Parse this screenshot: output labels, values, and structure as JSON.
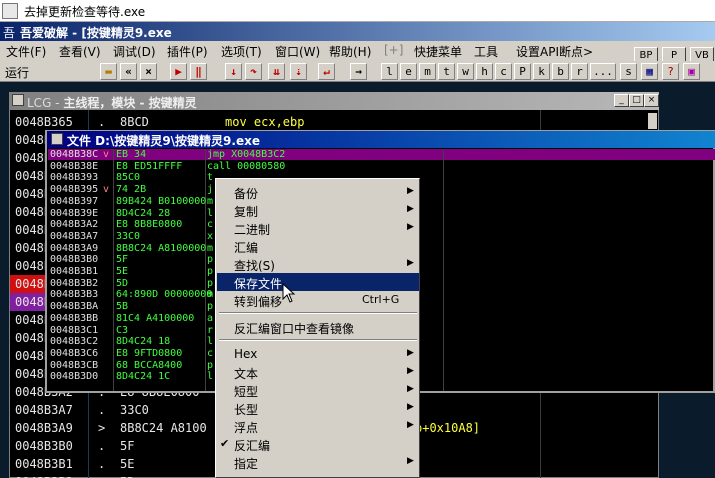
{
  "window": {
    "title": "去掉更新检查等待.exe"
  },
  "app": {
    "icon": "吾",
    "title": "吾爱破解 - [按键精灵9.exe"
  },
  "menu": {
    "items": [
      "文件(F)",
      "查看(V)",
      "调试(D)",
      "插件(P)",
      "选项(T)",
      "窗口(W)",
      "帮助(H)",
      "[+]",
      "快捷菜单",
      "工具",
      "设置API断点>"
    ],
    "right_buttons": [
      "BP",
      "P",
      "VB"
    ]
  },
  "toolbar": {
    "run_label": "运行",
    "letters": [
      "l",
      "e",
      "m",
      "t",
      "w",
      "h",
      "c",
      "P",
      "k",
      "b",
      "r",
      "...",
      "s"
    ]
  },
  "lcg": {
    "title_prefix": "LCG - ",
    "title_rest": "主线程，模块 - 按键精灵",
    "rows": [
      {
        "addr": "0048B365",
        "mark": ".",
        "hex": "8BCD",
        "dis": "mov ecx,ebp"
      },
      {
        "addr": "0048B367",
        "mark": "",
        "hex": "",
        "dis": ""
      },
      {
        "addr": "0048B36C",
        "mark": "",
        "hex": "",
        "dis": ""
      },
      {
        "addr": "0048B36E",
        "mark": "",
        "hex": "",
        "dis": ""
      },
      {
        "addr": "0048B371",
        "mark": "",
        "hex": "",
        "dis": ""
      },
      {
        "addr": "0048B378",
        "mark": "",
        "hex": "",
        "dis": ""
      },
      {
        "addr": "0048B37A",
        "mark": "",
        "hex": "",
        "dis": ""
      },
      {
        "addr": "0048B380",
        "mark": "",
        "hex": "",
        "dis": ""
      },
      {
        "addr": "0048B384",
        "mark": "",
        "hex": "",
        "dis": ""
      },
      {
        "addr": "0048B387",
        "mark": "",
        "hex": "",
        "dis": ""
      },
      {
        "addr": "0048B38C",
        "mark": "",
        "hex": "",
        "dis": ""
      },
      {
        "addr": "0048B393",
        "mark": "",
        "hex": "",
        "dis": ""
      },
      {
        "addr": "0048B395",
        "mark": "",
        "hex": "",
        "dis": ""
      },
      {
        "addr": "0048B397",
        "mark": "",
        "hex": "",
        "dis": ""
      },
      {
        "addr": "0048B39E",
        "mark": "",
        "hex": "",
        "dis": ""
      },
      {
        "addr": "0048B3A2",
        "mark": ".",
        "hex": "E8 8B8E0800",
        "dis": ""
      },
      {
        "addr": "0048B3A7",
        "mark": ".",
        "hex": "33C0",
        "dis": ""
      },
      {
        "addr": "0048B3A9",
        "mark": ">",
        "hex": "8B8C24 A8100",
        "dis": "p+0x10A8]"
      },
      {
        "addr": "0048B3B0",
        "mark": ".",
        "hex": "5F",
        "dis": ""
      },
      {
        "addr": "0048B3B1",
        "mark": ".",
        "hex": "5E",
        "dis": ""
      },
      {
        "addr": "0048B3B2",
        "mark": ".",
        "hex": "5D",
        "dis": ""
      }
    ]
  },
  "file_window": {
    "title": "文件 D:\\按键精灵9\\按键精灵9.exe",
    "rows": [
      {
        "addr": "0048B38C",
        "mark": "v",
        "hex": "EB 34",
        "dis": "jmp X0048B3C2"
      },
      {
        "addr": "0048B38E",
        "mark": "",
        "hex": "E8 ED51FFFF",
        "dis": "call 00080580"
      },
      {
        "addr": "0048B393",
        "mark": "",
        "hex": "85C0",
        "dis": "t"
      },
      {
        "addr": "0048B395",
        "mark": "v",
        "hex": "74 2B",
        "dis": "j"
      },
      {
        "addr": "0048B397",
        "mark": "",
        "hex": "89B424 B0100000",
        "dis": "m"
      },
      {
        "addr": "0048B39E",
        "mark": "",
        "hex": "8D4C24 28",
        "dis": "l"
      },
      {
        "addr": "0048B3A2",
        "mark": "",
        "hex": "E8 8B8E0800",
        "dis": "c"
      },
      {
        "addr": "0048B3A7",
        "mark": "",
        "hex": "33C0",
        "dis": "x"
      },
      {
        "addr": "0048B3A9",
        "mark": "",
        "hex": "8B8C24 A8100000",
        "dis": "m"
      },
      {
        "addr": "0048B3B0",
        "mark": "",
        "hex": "5F",
        "dis": "p"
      },
      {
        "addr": "0048B3B1",
        "mark": "",
        "hex": "5E",
        "dis": "p"
      },
      {
        "addr": "0048B3B2",
        "mark": "",
        "hex": "5D",
        "dis": "p"
      },
      {
        "addr": "0048B3B3",
        "mark": "",
        "hex": "64:890D 00000000",
        "dis": "m"
      },
      {
        "addr": "0048B3BA",
        "mark": "",
        "hex": "5B",
        "dis": "p"
      },
      {
        "addr": "0048B3BB",
        "mark": "",
        "hex": "81C4 A4100000",
        "dis": "a"
      },
      {
        "addr": "0048B3C1",
        "mark": "",
        "hex": "C3",
        "dis": "r"
      },
      {
        "addr": "0048B3C2",
        "mark": "",
        "hex": "8D4C24 18",
        "dis": "l"
      },
      {
        "addr": "0048B3C6",
        "mark": "",
        "hex": "E8 9FTD0800",
        "dis": "c"
      },
      {
        "addr": "0048B3CB",
        "mark": "",
        "hex": "68 BCCA8400",
        "dis": "p"
      },
      {
        "addr": "0048B3D0",
        "mark": "",
        "hex": "8D4C24 1C",
        "dis": "l"
      }
    ]
  },
  "context_menu": {
    "items": [
      {
        "label": "备份",
        "submenu": true
      },
      {
        "label": "复制",
        "submenu": true
      },
      {
        "label": "二进制",
        "submenu": true
      },
      {
        "label": "汇编",
        "submenu": false
      },
      {
        "label": "查找(S)",
        "submenu": true
      },
      {
        "label": "保存文件",
        "submenu": false,
        "selected": true
      },
      {
        "label": "转到偏移",
        "shortcut": "Ctrl+G",
        "submenu": false
      },
      {
        "label": "反汇编窗口中查看镜像",
        "submenu": false
      },
      {
        "label": "Hex",
        "submenu": true
      },
      {
        "label": "文本",
        "submenu": true
      },
      {
        "label": "短型",
        "submenu": true
      },
      {
        "label": "长型",
        "submenu": true
      },
      {
        "label": "浮点",
        "submenu": true
      },
      {
        "label": "反汇编",
        "submenu": false,
        "checked": true
      },
      {
        "label": "指定",
        "submenu": true
      }
    ]
  },
  "colors": {
    "selection": "#0a246a",
    "accent_purple": "#800080",
    "green_text": "#40ff40"
  }
}
